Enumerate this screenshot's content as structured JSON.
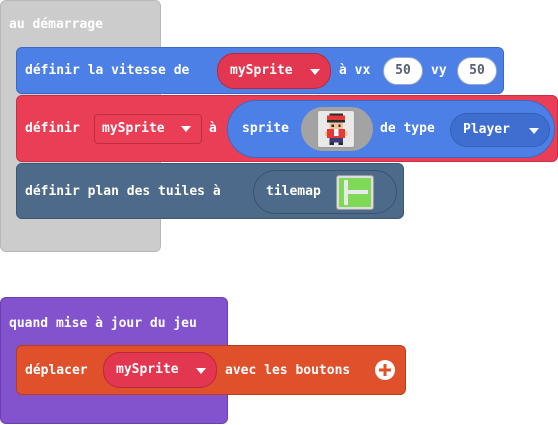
{
  "start_event": {
    "label": "au démarrage"
  },
  "set_velocity": {
    "prefix": "définir la vitesse de",
    "sprite_var": "mySprite",
    "vx_label": "à vx",
    "vx_value": "50",
    "vy_label": "vy",
    "vy_value": "50"
  },
  "set_sprite": {
    "prefix": "définir",
    "sprite_var": "mySprite",
    "to_label": "à",
    "sprite_label": "sprite",
    "kind_label": "de type",
    "kind_value": "Player"
  },
  "set_tilemap": {
    "label": "définir plan des tuiles à",
    "tilemap_label": "tilemap"
  },
  "update_event": {
    "label": "quand mise à jour du jeu"
  },
  "move_sprite": {
    "prefix": "déplacer",
    "sprite_var": "mySprite",
    "suffix": "avec les boutons"
  },
  "colors": {
    "events": "#cccccc",
    "sprites": "#4c80e6",
    "variables": "#ea3e56",
    "scene": "#4e6a8a",
    "game": "#8352cd",
    "controller": "#e0502b"
  }
}
